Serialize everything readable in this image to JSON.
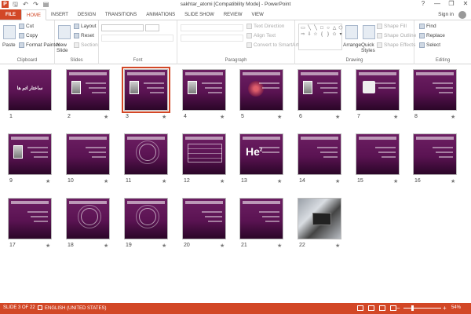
{
  "window": {
    "title": "sakhtar_atomi [Compatibility Mode] - PowerPoint",
    "help": "?",
    "min": "—",
    "max": "❐",
    "close": "✕"
  },
  "qat": {
    "save": "🖫",
    "undo": "↶",
    "redo": "↷",
    "present": "▤"
  },
  "tabs": [
    "FILE",
    "HOME",
    "INSERT",
    "DESIGN",
    "TRANSITIONS",
    "ANIMATIONS",
    "SLIDE SHOW",
    "REVIEW",
    "VIEW"
  ],
  "active_tab": "HOME",
  "signin": "Sign in",
  "ribbon": {
    "clipboard": {
      "paste": "Paste",
      "cut": "Cut",
      "copy": "Copy",
      "format_painter": "Format Painter",
      "label": "Clipboard"
    },
    "slides": {
      "new_slide": "New Slide",
      "layout": "Layout",
      "reset": "Reset",
      "section": "Section",
      "label": "Slides"
    },
    "font": {
      "label": "Font"
    },
    "paragraph": {
      "text_direction": "Text Direction",
      "align_text": "Align Text",
      "convert_smartart": "Convert to SmartArt",
      "label": "Paragraph"
    },
    "drawing": {
      "arrange": "Arrange",
      "quick_styles": "Quick Styles",
      "shape_fill": "Shape Fill",
      "shape_outline": "Shape Outline",
      "shape_effects": "Shape Effects",
      "label": "Drawing"
    },
    "editing": {
      "find": "Find",
      "replace": "Replace",
      "select": "Select",
      "label": "Editing"
    }
  },
  "slides": [
    {
      "num": "1",
      "star": "",
      "kind": "title",
      "text": "ساختار اتم ها"
    },
    {
      "num": "2",
      "star": "★",
      "kind": "portrait"
    },
    {
      "num": "3",
      "star": "★",
      "kind": "portrait",
      "selected": true
    },
    {
      "num": "4",
      "star": "★",
      "kind": "portrait"
    },
    {
      "num": "5",
      "star": "★",
      "kind": "dots"
    },
    {
      "num": "6",
      "star": "★",
      "kind": "portrait"
    },
    {
      "num": "7",
      "star": "★",
      "kind": "whitebox"
    },
    {
      "num": "8",
      "star": "★",
      "kind": "text"
    },
    {
      "num": "9",
      "star": "★",
      "kind": "portrait"
    },
    {
      "num": "10",
      "star": "★",
      "kind": "text"
    },
    {
      "num": "11",
      "star": "★",
      "kind": "orbit"
    },
    {
      "num": "12",
      "star": "★",
      "kind": "table"
    },
    {
      "num": "13",
      "star": "★",
      "kind": "he",
      "he": "He",
      "he_sup": "2"
    },
    {
      "num": "14",
      "star": "★",
      "kind": "text"
    },
    {
      "num": "15",
      "star": "★",
      "kind": "text"
    },
    {
      "num": "16",
      "star": "★",
      "kind": "text"
    },
    {
      "num": "17",
      "star": "★",
      "kind": "text"
    },
    {
      "num": "18",
      "star": "★",
      "kind": "orbit"
    },
    {
      "num": "19",
      "star": "★",
      "kind": "orbit"
    },
    {
      "num": "20",
      "star": "★",
      "kind": "text"
    },
    {
      "num": "21",
      "star": "★",
      "kind": "text"
    },
    {
      "num": "22",
      "star": "★",
      "kind": "photo"
    }
  ],
  "status": {
    "slide_info": "SLIDE 3 OF 22",
    "language": "ENGLISH (UNITED STATES)",
    "zoom_minus": "−",
    "zoom_plus": "+",
    "zoom": "54%",
    "zoom_value": 54
  },
  "colors": {
    "accent": "#d24726",
    "slide_bg": "#5a1352"
  }
}
